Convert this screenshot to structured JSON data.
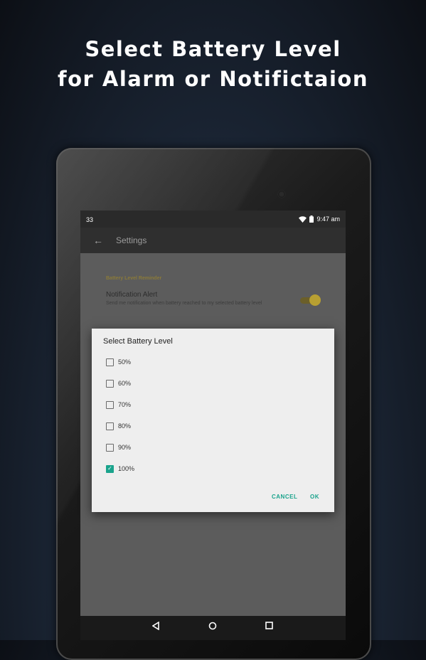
{
  "promo": {
    "line1": "Select Battery Level",
    "line2": "for Alarm or Notifictaion"
  },
  "statusbar": {
    "left_text": "33",
    "time": "9:47 am",
    "wifi_icon": "wifi-icon",
    "battery_icon": "battery-icon"
  },
  "appbar": {
    "back_icon": "arrow-back-icon",
    "title": "Settings"
  },
  "settings": {
    "section_header": "Battery Level Reminder",
    "notification_title": "Notification Alert",
    "notification_summary": "Send me notification when battery reached to my selected battery level",
    "notification_enabled": true
  },
  "dialog": {
    "title": "Select Battery Level",
    "options": [
      {
        "label": "50%",
        "checked": false
      },
      {
        "label": "60%",
        "checked": false
      },
      {
        "label": "70%",
        "checked": false
      },
      {
        "label": "80%",
        "checked": false
      },
      {
        "label": "90%",
        "checked": false
      },
      {
        "label": "100%",
        "checked": true
      }
    ],
    "cancel_label": "CANCEL",
    "ok_label": "OK"
  },
  "navbar": {
    "back": "back-triangle-icon",
    "home": "home-circle-icon",
    "recents": "recents-square-icon"
  },
  "colors": {
    "accent": "#1aa38c",
    "toggle": "#b8a032"
  }
}
